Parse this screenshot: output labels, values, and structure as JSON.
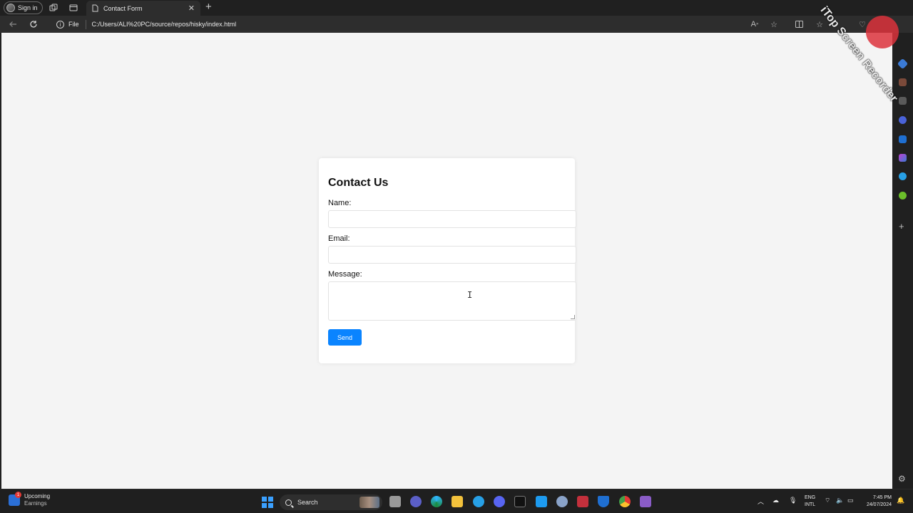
{
  "browser": {
    "profile_label": "Sign in",
    "tab_title": "Contact Form",
    "file_label": "File",
    "url": "C:/Users/ALI%20PC/source/repos/hisky/index.html"
  },
  "form": {
    "heading": "Contact Us",
    "name_label": "Name:",
    "name_value": "",
    "email_label": "Email:",
    "email_value": "",
    "message_label": "Message:",
    "message_value": "",
    "send_label": "Send",
    "accent_color": "#0a84ff"
  },
  "watermark": {
    "text": "iTop Screen Recorder"
  },
  "taskbar": {
    "widget_title": "Upcoming",
    "widget_subtitle": "Earnings",
    "widget_badge": "1",
    "search_placeholder": "Search",
    "language_top": "ENG",
    "language_bottom": "INTL",
    "time": "7:45 PM",
    "date": "24/07/2024"
  },
  "icons": {
    "sidebar": [
      "copilot-icon",
      "shopping-icon",
      "tools-icon",
      "games-icon",
      "microsoft365-icon",
      "outlook-icon",
      "designer-icon",
      "telegram-icon",
      "tree-icon",
      "add-icon",
      "settings-icon"
    ],
    "taskbar_apps": [
      "start-icon",
      "file-icon",
      "teams-icon",
      "edge-icon",
      "explorer-icon",
      "cloud-icon",
      "discord-icon",
      "tradingview-icon",
      "twitter-icon",
      "r-icon",
      "recorder-icon",
      "defender-icon",
      "chrome-icon",
      "visual-studio-icon"
    ]
  }
}
